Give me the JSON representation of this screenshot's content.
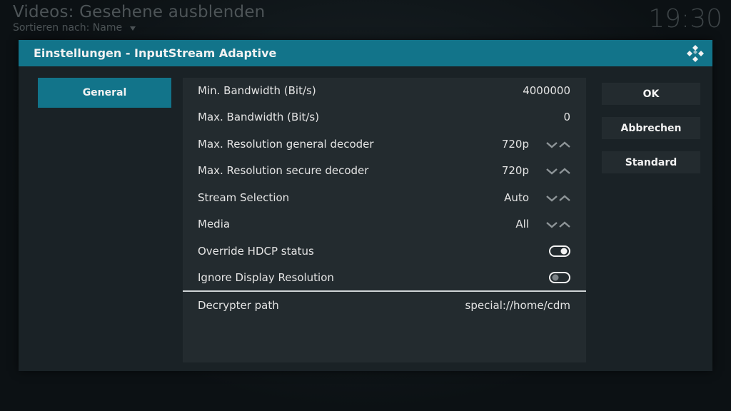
{
  "background": {
    "title": "Videos: Gesehene ausblenden",
    "sort_label": "Sortieren nach: Name",
    "sort_arrow_icon": "caret-down-icon",
    "clock": "19:30"
  },
  "dialog": {
    "title": "Einstellungen - InputStream Adaptive",
    "logo_icon": "kodi-logo-icon",
    "categories": [
      {
        "label": "General"
      }
    ],
    "settings": [
      {
        "label": "Min. Bandwidth (Bit/s)",
        "value": "4000000",
        "type": "text"
      },
      {
        "label": "Max. Bandwidth (Bit/s)",
        "value": "0",
        "type": "text"
      },
      {
        "label": "Max. Resolution general decoder",
        "value": "720p",
        "type": "spinner"
      },
      {
        "label": "Max. Resolution secure decoder",
        "value": "720p",
        "type": "spinner"
      },
      {
        "label": "Stream Selection",
        "value": "Auto",
        "type": "spinner"
      },
      {
        "label": "Media",
        "value": "All",
        "type": "spinner"
      },
      {
        "label": "Override HDCP status",
        "type": "toggle",
        "enabled": true
      },
      {
        "label": "Ignore Display Resolution",
        "type": "toggle",
        "enabled": false
      },
      {
        "label": "Decrypter path",
        "value": "special://home/cdm",
        "type": "text"
      }
    ],
    "buttons": {
      "ok": "OK",
      "cancel": "Abbrechen",
      "default": "Standard"
    }
  },
  "colors": {
    "accent": "#12748a",
    "panel": "#232b2f",
    "dialog_bg": "#1a2226"
  }
}
